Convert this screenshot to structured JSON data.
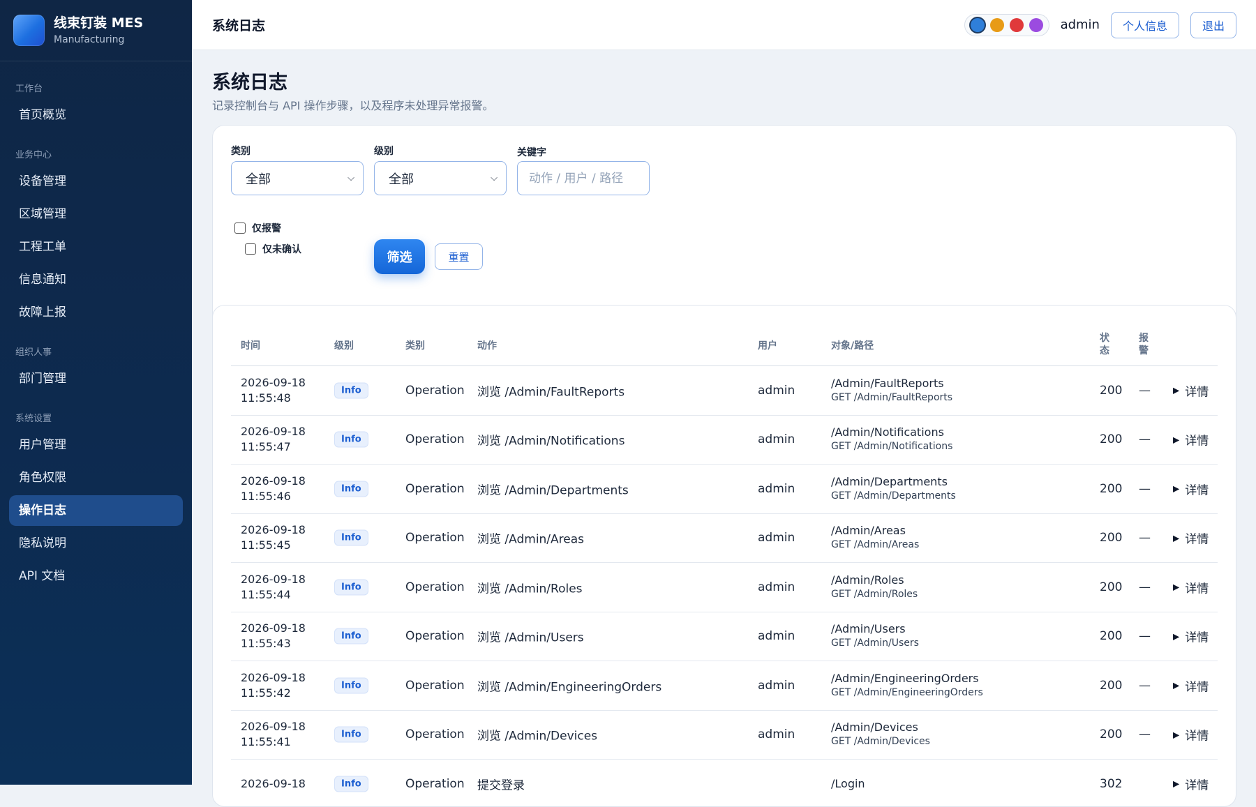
{
  "app": {
    "name": "线束钉装 MES",
    "subtitle": "Manufacturing"
  },
  "sidebar": {
    "groups": [
      {
        "title": "工作台",
        "items": [
          {
            "label": "首页概览"
          }
        ]
      },
      {
        "title": "业务中心",
        "items": [
          {
            "label": "设备管理"
          },
          {
            "label": "区域管理"
          },
          {
            "label": "工程工单"
          },
          {
            "label": "信息通知"
          },
          {
            "label": "故障上报"
          }
        ]
      },
      {
        "title": "组织人事",
        "items": [
          {
            "label": "部门管理"
          }
        ]
      },
      {
        "title": "系统设置",
        "items": [
          {
            "label": "用户管理"
          },
          {
            "label": "角色权限"
          },
          {
            "label": "操作日志",
            "active": true
          },
          {
            "label": "隐私说明"
          },
          {
            "label": "API 文档"
          }
        ]
      }
    ]
  },
  "topbar": {
    "title": "系统日志",
    "theme_colors": [
      "#2f7fd9",
      "#e89b16",
      "#e0393b",
      "#9b4be0"
    ],
    "username": "admin",
    "profile_label": "个人信息",
    "logout_label": "退出"
  },
  "page": {
    "title": "系统日志",
    "description": "记录控制台与 API 操作步骤，以及程序未处理异常报警。"
  },
  "filters": {
    "category_label": "类别",
    "category_value": "全部",
    "level_label": "级别",
    "level_value": "全部",
    "keyword_label": "关键字",
    "keyword_placeholder": "动作 / 用户 / 路径",
    "alarm_only_label": "仅报警",
    "unconfirmed_only_label": "仅未确认",
    "filter_button": "筛选",
    "reset_button": "重置"
  },
  "table": {
    "headers": {
      "time": "时间",
      "level": "级别",
      "category": "类别",
      "action": "动作",
      "user": "用户",
      "target": "对象/路径",
      "status": "状\n态",
      "alarm": "报\n警"
    },
    "rows": [
      {
        "date": "2026-09-18",
        "time": "11:55:48",
        "level": "Info",
        "category": "Operation",
        "action": "浏览 /Admin/FaultReports",
        "user": "admin",
        "path": "/Admin/FaultReports",
        "request": "GET /Admin/FaultReports",
        "status": "200",
        "alarm": "—",
        "details": "详情"
      },
      {
        "date": "2026-09-18",
        "time": "11:55:47",
        "level": "Info",
        "category": "Operation",
        "action": "浏览 /Admin/Notifications",
        "user": "admin",
        "path": "/Admin/Notifications",
        "request": "GET /Admin/Notifications",
        "status": "200",
        "alarm": "—",
        "details": "详情"
      },
      {
        "date": "2026-09-18",
        "time": "11:55:46",
        "level": "Info",
        "category": "Operation",
        "action": "浏览 /Admin/Departments",
        "user": "admin",
        "path": "/Admin/Departments",
        "request": "GET /Admin/Departments",
        "status": "200",
        "alarm": "—",
        "details": "详情"
      },
      {
        "date": "2026-09-18",
        "time": "11:55:45",
        "level": "Info",
        "category": "Operation",
        "action": "浏览 /Admin/Areas",
        "user": "admin",
        "path": "/Admin/Areas",
        "request": "GET /Admin/Areas",
        "status": "200",
        "alarm": "—",
        "details": "详情"
      },
      {
        "date": "2026-09-18",
        "time": "11:55:44",
        "level": "Info",
        "category": "Operation",
        "action": "浏览 /Admin/Roles",
        "user": "admin",
        "path": "/Admin/Roles",
        "request": "GET /Admin/Roles",
        "status": "200",
        "alarm": "—",
        "details": "详情"
      },
      {
        "date": "2026-09-18",
        "time": "11:55:43",
        "level": "Info",
        "category": "Operation",
        "action": "浏览 /Admin/Users",
        "user": "admin",
        "path": "/Admin/Users",
        "request": "GET /Admin/Users",
        "status": "200",
        "alarm": "—",
        "details": "详情"
      },
      {
        "date": "2026-09-18",
        "time": "11:55:42",
        "level": "Info",
        "category": "Operation",
        "action": "浏览 /Admin/EngineeringOrders",
        "user": "admin",
        "path": "/Admin/EngineeringOrders",
        "request": "GET /Admin/EngineeringOrders",
        "status": "200",
        "alarm": "—",
        "details": "详情"
      },
      {
        "date": "2026-09-18",
        "time": "11:55:41",
        "level": "Info",
        "category": "Operation",
        "action": "浏览 /Admin/Devices",
        "user": "admin",
        "path": "/Admin/Devices",
        "request": "GET /Admin/Devices",
        "status": "200",
        "alarm": "—",
        "details": "详情"
      },
      {
        "date": "2026-09-18",
        "time": "",
        "level": "Info",
        "category": "Operation",
        "action": "提交登录",
        "user": "",
        "path": "/Login",
        "request": "",
        "status": "302",
        "alarm": "",
        "details": "详情"
      }
    ]
  }
}
